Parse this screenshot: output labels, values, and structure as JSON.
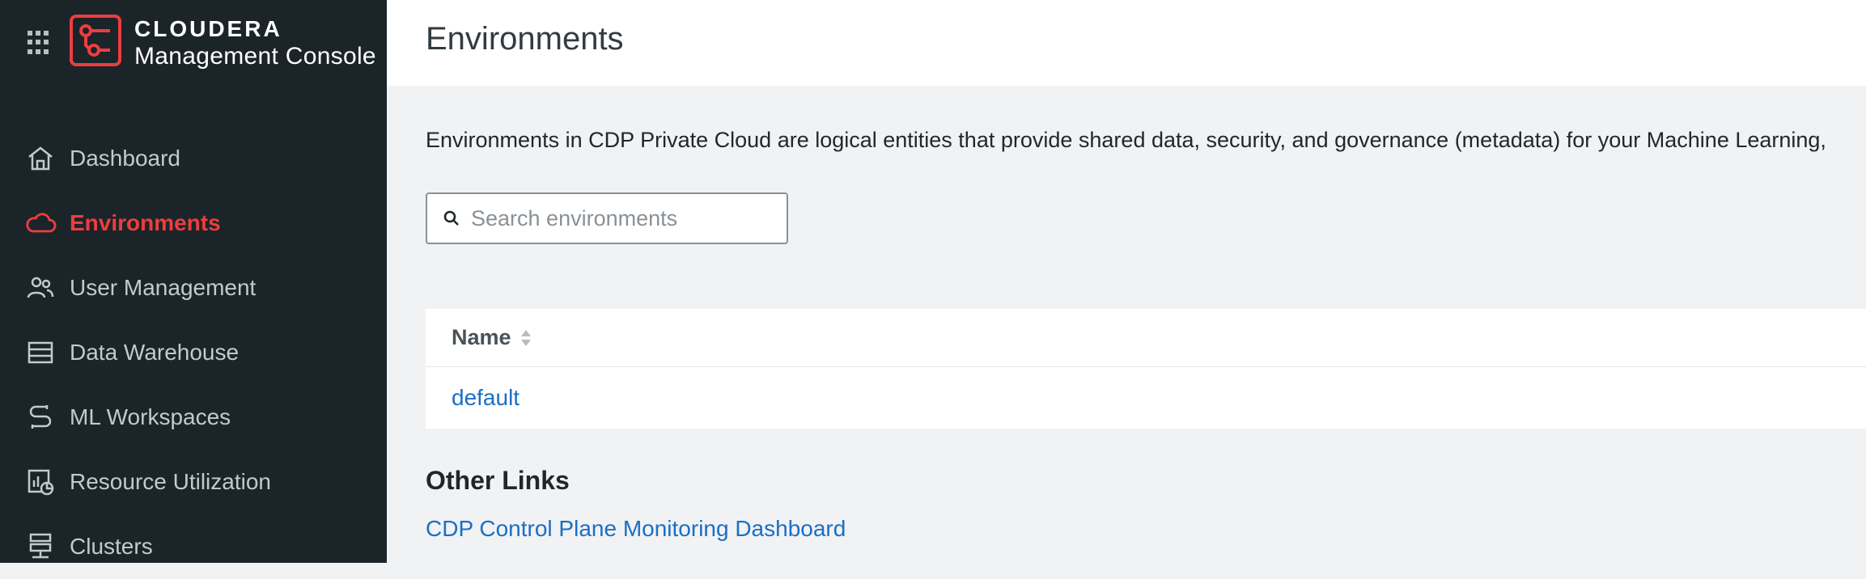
{
  "brand": {
    "name": "CLOUDERA",
    "product": "Management Console",
    "accent_color": "#ee3d3d"
  },
  "nav": {
    "items": [
      {
        "label": "Dashboard",
        "icon": "home-icon",
        "active": false
      },
      {
        "label": "Environments",
        "icon": "cloud-icon",
        "active": true
      },
      {
        "label": "User Management",
        "icon": "users-icon",
        "active": false
      },
      {
        "label": "Data Warehouse",
        "icon": "warehouse-icon",
        "active": false
      },
      {
        "label": "ML Workspaces",
        "icon": "ml-workspaces-icon",
        "active": false
      },
      {
        "label": "Resource Utilization",
        "icon": "resource-utilization-icon",
        "active": false
      },
      {
        "label": "Clusters",
        "icon": "clusters-icon",
        "active": false
      }
    ]
  },
  "page": {
    "title": "Environments",
    "description": "Environments in CDP Private Cloud are logical entities that provide shared data, security, and governance (metadata) for your Machine Learning,"
  },
  "search": {
    "placeholder": "Search environments",
    "value": ""
  },
  "table": {
    "columns": [
      "Name"
    ],
    "rows": [
      {
        "name": "default"
      }
    ]
  },
  "other_links": {
    "title": "Other Links",
    "links": [
      "CDP Control Plane Monitoring Dashboard"
    ]
  },
  "colors": {
    "sidebar_bg": "#1b2429",
    "link": "#1a6fc4",
    "page_bg": "#f1f2f4"
  }
}
